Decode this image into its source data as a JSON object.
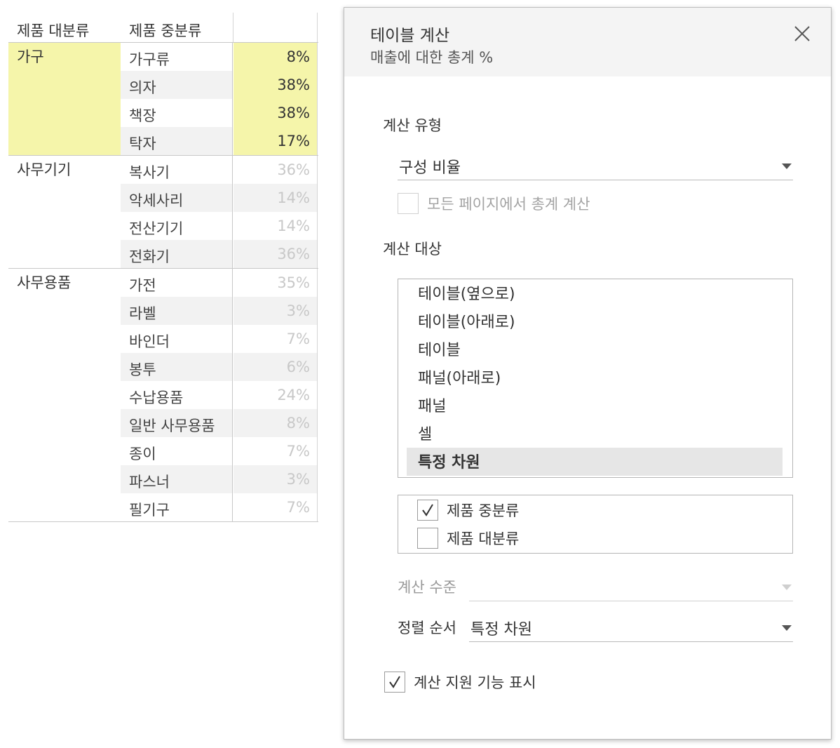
{
  "crosstab": {
    "header_category": "제품 대분류",
    "header_subcategory": "제품 중분류",
    "groups": [
      {
        "label": "가구",
        "highlighted": true,
        "rows": [
          {
            "name": "가구류",
            "value": "8%"
          },
          {
            "name": "의자",
            "value": "38%"
          },
          {
            "name": "책장",
            "value": "38%"
          },
          {
            "name": "탁자",
            "value": "17%"
          }
        ]
      },
      {
        "label": "사무기기",
        "highlighted": false,
        "rows": [
          {
            "name": "복사기",
            "value": "36%"
          },
          {
            "name": "악세사리",
            "value": "14%"
          },
          {
            "name": "전산기기",
            "value": "14%"
          },
          {
            "name": "전화기",
            "value": "36%"
          }
        ]
      },
      {
        "label": "사무용품",
        "highlighted": false,
        "rows": [
          {
            "name": "가전",
            "value": "35%"
          },
          {
            "name": "라벨",
            "value": "3%"
          },
          {
            "name": "바인더",
            "value": "7%"
          },
          {
            "name": "봉투",
            "value": "6%"
          },
          {
            "name": "수납용품",
            "value": "24%"
          },
          {
            "name": "일반 사무용품",
            "value": "8%"
          },
          {
            "name": "종이",
            "value": "7%"
          },
          {
            "name": "파스너",
            "value": "3%"
          },
          {
            "name": "필기구",
            "value": "7%"
          }
        ]
      }
    ]
  },
  "dialog": {
    "title": "테이블 계산",
    "subtitle": "매출에 대한 총계 %",
    "calc_type_label": "계산 유형",
    "calc_type_value": "구성 비율",
    "all_pages_label": "모든 페이지에서 총계 계산",
    "compute_using_label": "계산 대상",
    "compute_using_options": [
      "테이블(옆으로)",
      "테이블(아래로)",
      "테이블",
      "패널(아래로)",
      "패널",
      "셀",
      "특정 차원"
    ],
    "selected_option": "특정 차원",
    "dimensions": [
      {
        "label": "제품 중분류",
        "checked": true
      },
      {
        "label": "제품 대분류",
        "checked": false
      }
    ],
    "level_label": "계산 수준",
    "sort_label": "정렬 순서",
    "sort_value": "특정 차원",
    "show_assist_label": "계산 지원 기능 표시",
    "show_assist_checked": true
  },
  "colors": {
    "highlight": "#f5f5aa",
    "dim_text": "#c8c8c8",
    "header_bg": "#f4f4f4",
    "selected_bg": "#e6e6e6"
  }
}
